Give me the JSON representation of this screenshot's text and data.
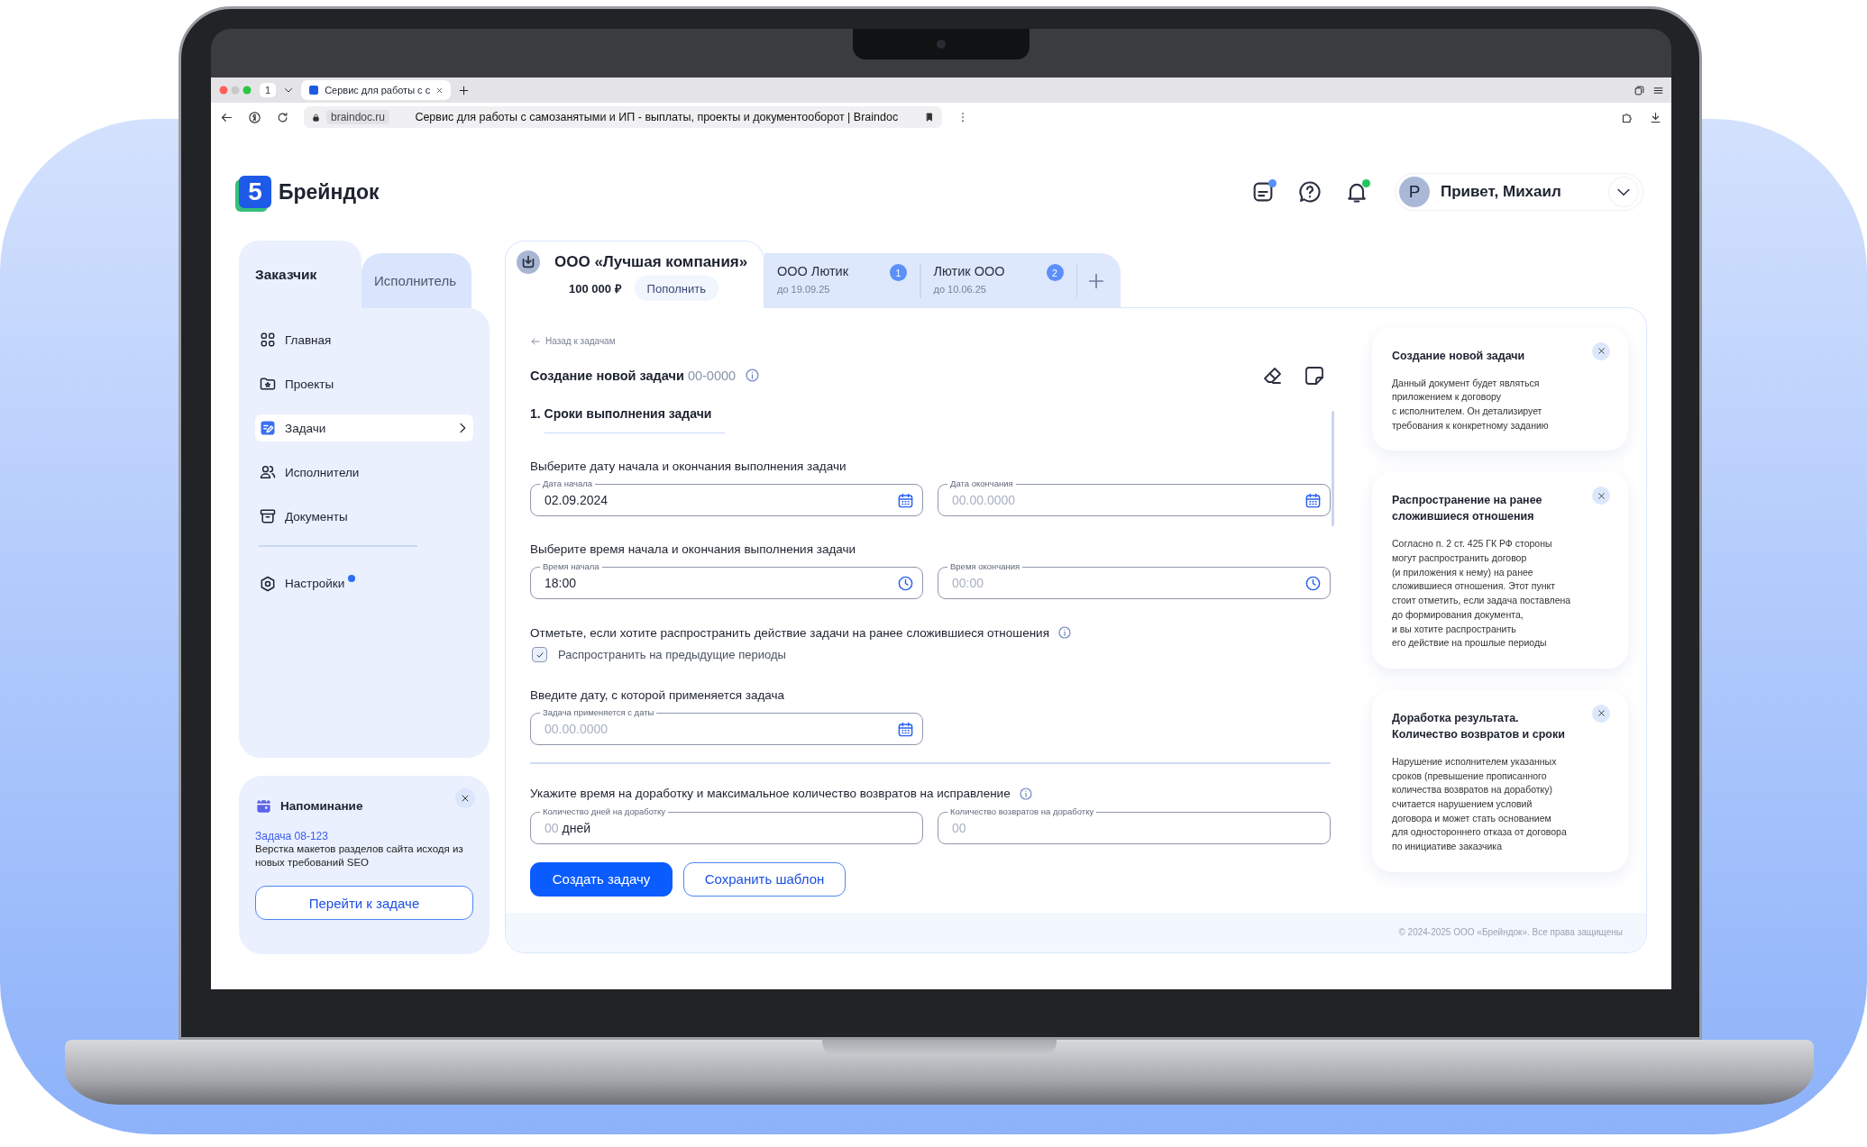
{
  "browser": {
    "tab_count": "1",
    "tab_title": "Сервис для работы с с",
    "url": "braindoc.ru",
    "page_title": "Сервис для работы с самозанятыми и ИП - выплаты, проекты и документооборот | Braindoc"
  },
  "header": {
    "logo_mark": "5",
    "logo_text": "Брейндок",
    "icons": [
      {
        "kind": "notes",
        "color": "#5b8ff9"
      },
      {
        "kind": "help"
      },
      {
        "kind": "bell",
        "color": "#22c55e"
      }
    ],
    "user": {
      "avatar": "Р",
      "greeting": "Привет, Михаил"
    }
  },
  "sidebar": {
    "role_tabs": [
      {
        "label": "Заказчик",
        "selected": true
      },
      {
        "label": "Исполнитель",
        "selected": false
      }
    ],
    "items": [
      {
        "kind": "home",
        "label": "Главная",
        "selected": false,
        "dot": false
      },
      {
        "kind": "projects",
        "label": "Проекты",
        "selected": false,
        "dot": false
      },
      {
        "kind": "tasks",
        "label": "Задачи",
        "selected": true,
        "dot": false
      },
      {
        "kind": "people",
        "label": "Исполнители",
        "selected": false,
        "dot": false
      },
      {
        "kind": "documents",
        "label": "Документы",
        "selected": false,
        "dot": false
      },
      {
        "kind": "divider"
      },
      {
        "kind": "settings",
        "label": "Настройки",
        "selected": false,
        "dot": true
      }
    ]
  },
  "reminder": {
    "title": "Напоминание",
    "link": "Задача 08-123",
    "text": "Верстка макетов разделов сайта исходя из новых требований SEO",
    "button": "Перейти к задаче"
  },
  "company_tabs": [
    {
      "kind": "account",
      "name": "ООО «Лучшая компания»",
      "balance": "100 000 ₽",
      "action": "Пополнить",
      "selected": true
    },
    {
      "kind": "company",
      "name": "ООО Лютик",
      "deadline": "до 19.09.25",
      "badge": "1",
      "selected": false
    },
    {
      "kind": "company",
      "name": "Лютик ООО",
      "deadline": "до 10.06.25",
      "badge": "2",
      "selected": false
    }
  ],
  "form": {
    "back_link": "Назад к задачам",
    "title": "Создание новой задачи",
    "number": "00-0000",
    "section": "1. Сроки выполнения задачи",
    "blocks": [
      {
        "kind": "fields",
        "label": "Выберите дату начала и окончания выполнения задачи",
        "info": false,
        "fields": [
          {
            "kind": "date",
            "label": "Дата начала",
            "value": "02.09.2024"
          },
          {
            "kind": "date",
            "label": "Дата окончания",
            "placeholder": "00.00.0000"
          }
        ]
      },
      {
        "kind": "fields",
        "label": "Выберите время начала и окончания выполнения задачи",
        "info": false,
        "fields": [
          {
            "kind": "time",
            "label": "Время начала",
            "value": "18:00"
          },
          {
            "kind": "time",
            "label": "Время окончания",
            "placeholder": "00:00"
          }
        ]
      },
      {
        "kind": "checkbox",
        "label": "Отметьте, если хотите распространить действие задачи на ранее сложившиеся отношения",
        "info": true,
        "option": {
          "label": "Распространить на предыдущие периоды",
          "checked": true
        }
      },
      {
        "kind": "fields",
        "label": "Введите дату, с которой применяется задача",
        "info": false,
        "fields": [
          {
            "kind": "date",
            "label": "Задача применяется с даты",
            "placeholder": "00.00.0000"
          }
        ]
      },
      {
        "kind": "divider"
      },
      {
        "kind": "fields",
        "label": "Укажите время на доработку и максимальное количество возвратов на исправление",
        "info": true,
        "fields": [
          {
            "kind": "number",
            "label": "Количество дней на доработку",
            "placeholder": "00",
            "suffix": "дней"
          },
          {
            "kind": "number",
            "label": "Количество возвратов на доработку",
            "placeholder": "00"
          }
        ]
      }
    ],
    "buttons": [
      {
        "kind": "primary",
        "label": "Создать задачу"
      },
      {
        "kind": "secondary",
        "label": "Сохранить шаблон"
      }
    ]
  },
  "help_cards": [
    {
      "title": "Создание новой задачи",
      "text": "Данный документ будет являться\nприложением к договору\nс исполнителем. Он детализирует\nтребования к конкретному заданию"
    },
    {
      "title": "Распространение на ранее сложившиеся отношения",
      "text": "Согласно п. 2 ст. 425 ГК РФ стороны\nмогут распространить договор\n(и приложения к нему) на ранее\nсложившиеся отношения. Этот пункт\nстоит отметить, если задача поставлена\nдо формирования документа,\nи вы хотите распространить\nего действие на прошлые периоды"
    },
    {
      "title": "Доработка результата. Количество возвратов и сроки",
      "text": "Нарушение исполнителем указанных\nсроков (превышение прописанного\nколичества возвратов на доработку)\nсчитается нарушением условий\nдоговора и может стать основанием\nдля одностороннего отказа от договора\nпо инициативе заказчика"
    }
  ],
  "footer": "© 2024-2025 ООО «Брейндок». Все права защищены"
}
